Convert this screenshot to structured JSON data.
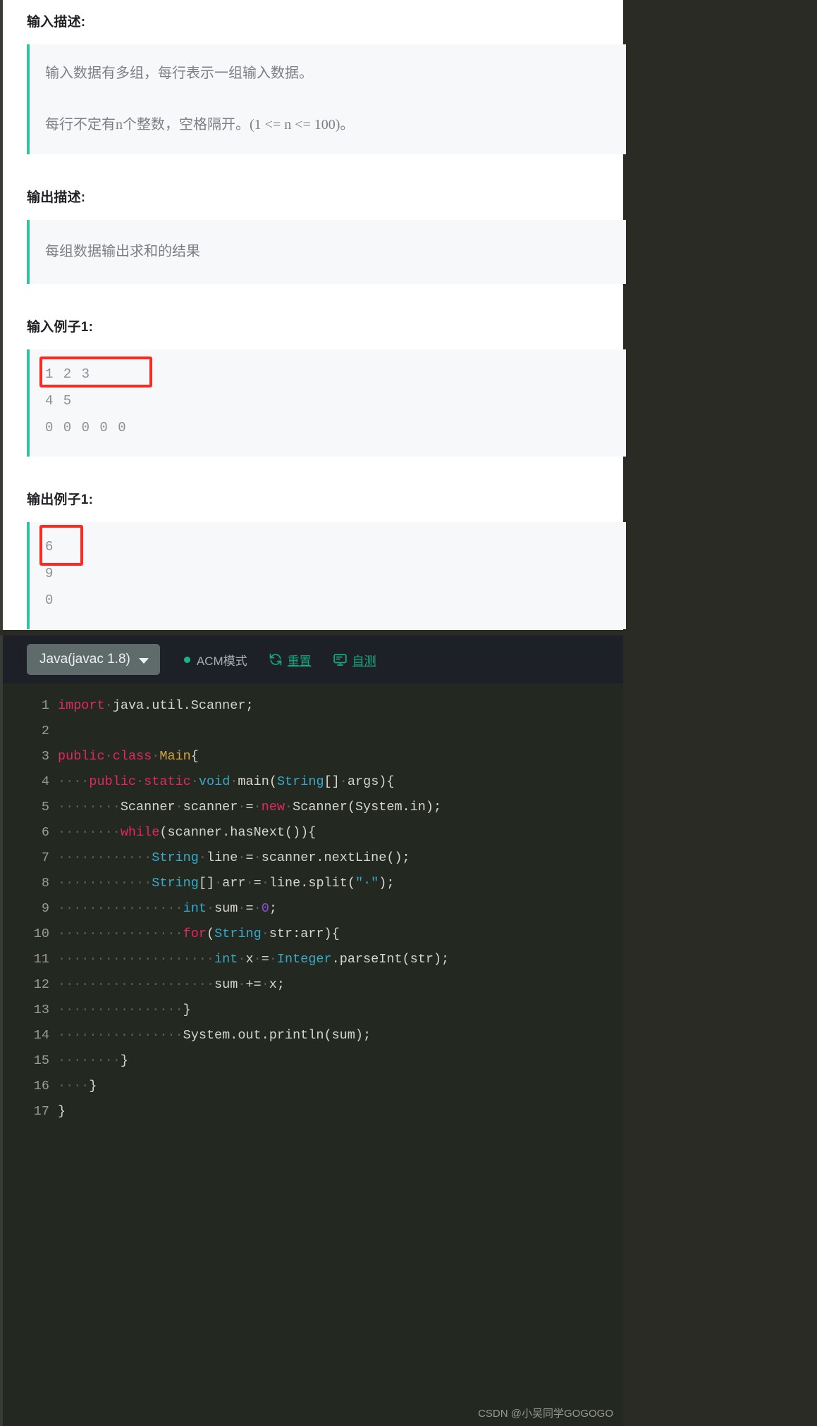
{
  "problem": {
    "input_desc_title": "输入描述:",
    "input_desc_lines": [
      "输入数据有多组，每行表示一组输入数据。",
      "每行不定有n个整数，空格隔开。(1 <= n <= 100)。"
    ],
    "output_desc_title": "输出描述:",
    "output_desc_lines": [
      "每组数据输出求和的结果"
    ],
    "input_example_title": "输入例子1:",
    "input_example_lines": [
      "1 2 3",
      "4 5",
      "0 0 0 0 0"
    ],
    "output_example_title": "输出例子1:",
    "output_example_lines": [
      "6",
      "9",
      "0"
    ]
  },
  "editor": {
    "language": "Java(javac 1.8)",
    "mode_label": "ACM模式",
    "reset_label": "重置",
    "selftest_label": "自测",
    "code_lines": [
      {
        "no": "1",
        "tokens": [
          {
            "t": "import",
            "c": "kw"
          },
          {
            "t": "·",
            "c": "dot-space"
          },
          {
            "t": "java.util.Scanner;",
            "c": "plain"
          }
        ]
      },
      {
        "no": "2",
        "tokens": []
      },
      {
        "no": "3",
        "tokens": [
          {
            "t": "public",
            "c": "kw"
          },
          {
            "t": "·",
            "c": "dot-space"
          },
          {
            "t": "class",
            "c": "kw"
          },
          {
            "t": "·",
            "c": "dot-space"
          },
          {
            "t": "Main",
            "c": "cls"
          },
          {
            "t": "{",
            "c": "plain"
          }
        ]
      },
      {
        "no": "4",
        "tokens": [
          {
            "t": "····",
            "c": "dot-space"
          },
          {
            "t": "public",
            "c": "kw"
          },
          {
            "t": "·",
            "c": "dot-space"
          },
          {
            "t": "static",
            "c": "kw"
          },
          {
            "t": "·",
            "c": "dot-space"
          },
          {
            "t": "void",
            "c": "typ"
          },
          {
            "t": "·",
            "c": "dot-space"
          },
          {
            "t": "main(",
            "c": "plain"
          },
          {
            "t": "String",
            "c": "typ"
          },
          {
            "t": "[]",
            "c": "plain"
          },
          {
            "t": "·",
            "c": "dot-space"
          },
          {
            "t": "args){",
            "c": "plain"
          }
        ]
      },
      {
        "no": "5",
        "tokens": [
          {
            "t": "········",
            "c": "dot-space"
          },
          {
            "t": "Scanner",
            "c": "plain"
          },
          {
            "t": "·",
            "c": "dot-space"
          },
          {
            "t": "scanner",
            "c": "plain"
          },
          {
            "t": "·",
            "c": "dot-space"
          },
          {
            "t": "=",
            "c": "plain"
          },
          {
            "t": "·",
            "c": "dot-space"
          },
          {
            "t": "new",
            "c": "kw"
          },
          {
            "t": "·",
            "c": "dot-space"
          },
          {
            "t": "Scanner(System.in);",
            "c": "plain"
          }
        ]
      },
      {
        "no": "6",
        "tokens": [
          {
            "t": "········",
            "c": "dot-space"
          },
          {
            "t": "while",
            "c": "kw"
          },
          {
            "t": "(scanner.hasNext()){",
            "c": "plain"
          }
        ]
      },
      {
        "no": "7",
        "tokens": [
          {
            "t": "············",
            "c": "dot-space"
          },
          {
            "t": "String",
            "c": "typ"
          },
          {
            "t": "·",
            "c": "dot-space"
          },
          {
            "t": "line",
            "c": "plain"
          },
          {
            "t": "·",
            "c": "dot-space"
          },
          {
            "t": "=",
            "c": "plain"
          },
          {
            "t": "·",
            "c": "dot-space"
          },
          {
            "t": "scanner.nextLine();",
            "c": "plain"
          }
        ]
      },
      {
        "no": "8",
        "tokens": [
          {
            "t": "············",
            "c": "dot-space"
          },
          {
            "t": "String",
            "c": "typ"
          },
          {
            "t": "[]",
            "c": "plain"
          },
          {
            "t": "·",
            "c": "dot-space"
          },
          {
            "t": "arr",
            "c": "plain"
          },
          {
            "t": "·",
            "c": "dot-space"
          },
          {
            "t": "=",
            "c": "plain"
          },
          {
            "t": "·",
            "c": "dot-space"
          },
          {
            "t": "line.split(",
            "c": "plain"
          },
          {
            "t": "\"·\"",
            "c": "str"
          },
          {
            "t": ");",
            "c": "plain"
          }
        ]
      },
      {
        "no": "9",
        "tokens": [
          {
            "t": "················",
            "c": "dot-space"
          },
          {
            "t": "int",
            "c": "typ"
          },
          {
            "t": "·",
            "c": "dot-space"
          },
          {
            "t": "sum",
            "c": "plain"
          },
          {
            "t": "·",
            "c": "dot-space"
          },
          {
            "t": "=",
            "c": "plain"
          },
          {
            "t": "·",
            "c": "dot-space"
          },
          {
            "t": "0",
            "c": "num"
          },
          {
            "t": ";",
            "c": "plain"
          }
        ]
      },
      {
        "no": "10",
        "tokens": [
          {
            "t": "················",
            "c": "dot-space"
          },
          {
            "t": "for",
            "c": "kw"
          },
          {
            "t": "(",
            "c": "plain"
          },
          {
            "t": "String",
            "c": "typ"
          },
          {
            "t": "·",
            "c": "dot-space"
          },
          {
            "t": "str:arr){",
            "c": "plain"
          }
        ]
      },
      {
        "no": "11",
        "tokens": [
          {
            "t": "····················",
            "c": "dot-space"
          },
          {
            "t": "int",
            "c": "typ"
          },
          {
            "t": "·",
            "c": "dot-space"
          },
          {
            "t": "x",
            "c": "plain"
          },
          {
            "t": "·",
            "c": "dot-space"
          },
          {
            "t": "=",
            "c": "plain"
          },
          {
            "t": "·",
            "c": "dot-space"
          },
          {
            "t": "Integer",
            "c": "typ"
          },
          {
            "t": ".parseInt(str);",
            "c": "plain"
          }
        ]
      },
      {
        "no": "12",
        "tokens": [
          {
            "t": "····················",
            "c": "dot-space"
          },
          {
            "t": "sum",
            "c": "plain"
          },
          {
            "t": "·",
            "c": "dot-space"
          },
          {
            "t": "+=",
            "c": "plain"
          },
          {
            "t": "·",
            "c": "dot-space"
          },
          {
            "t": "x;",
            "c": "plain"
          }
        ]
      },
      {
        "no": "13",
        "tokens": [
          {
            "t": "················",
            "c": "dot-space"
          },
          {
            "t": "}",
            "c": "plain"
          }
        ]
      },
      {
        "no": "14",
        "tokens": [
          {
            "t": "················",
            "c": "dot-space"
          },
          {
            "t": "System.out.println(sum);",
            "c": "plain"
          }
        ]
      },
      {
        "no": "15",
        "tokens": [
          {
            "t": "········",
            "c": "dot-space"
          },
          {
            "t": "}",
            "c": "plain"
          }
        ]
      },
      {
        "no": "16",
        "tokens": [
          {
            "t": "····",
            "c": "dot-space"
          },
          {
            "t": "}",
            "c": "plain"
          }
        ]
      },
      {
        "no": "17",
        "tokens": [
          {
            "t": "}",
            "c": "plain"
          }
        ]
      }
    ]
  },
  "watermark": "CSDN @小吴同学GOGOGO",
  "colors": {
    "accent_green": "#2ec4a0",
    "annotation_red": "#fc2a20",
    "editor_bg": "#232821",
    "toolbar_bg": "#1d2127"
  }
}
